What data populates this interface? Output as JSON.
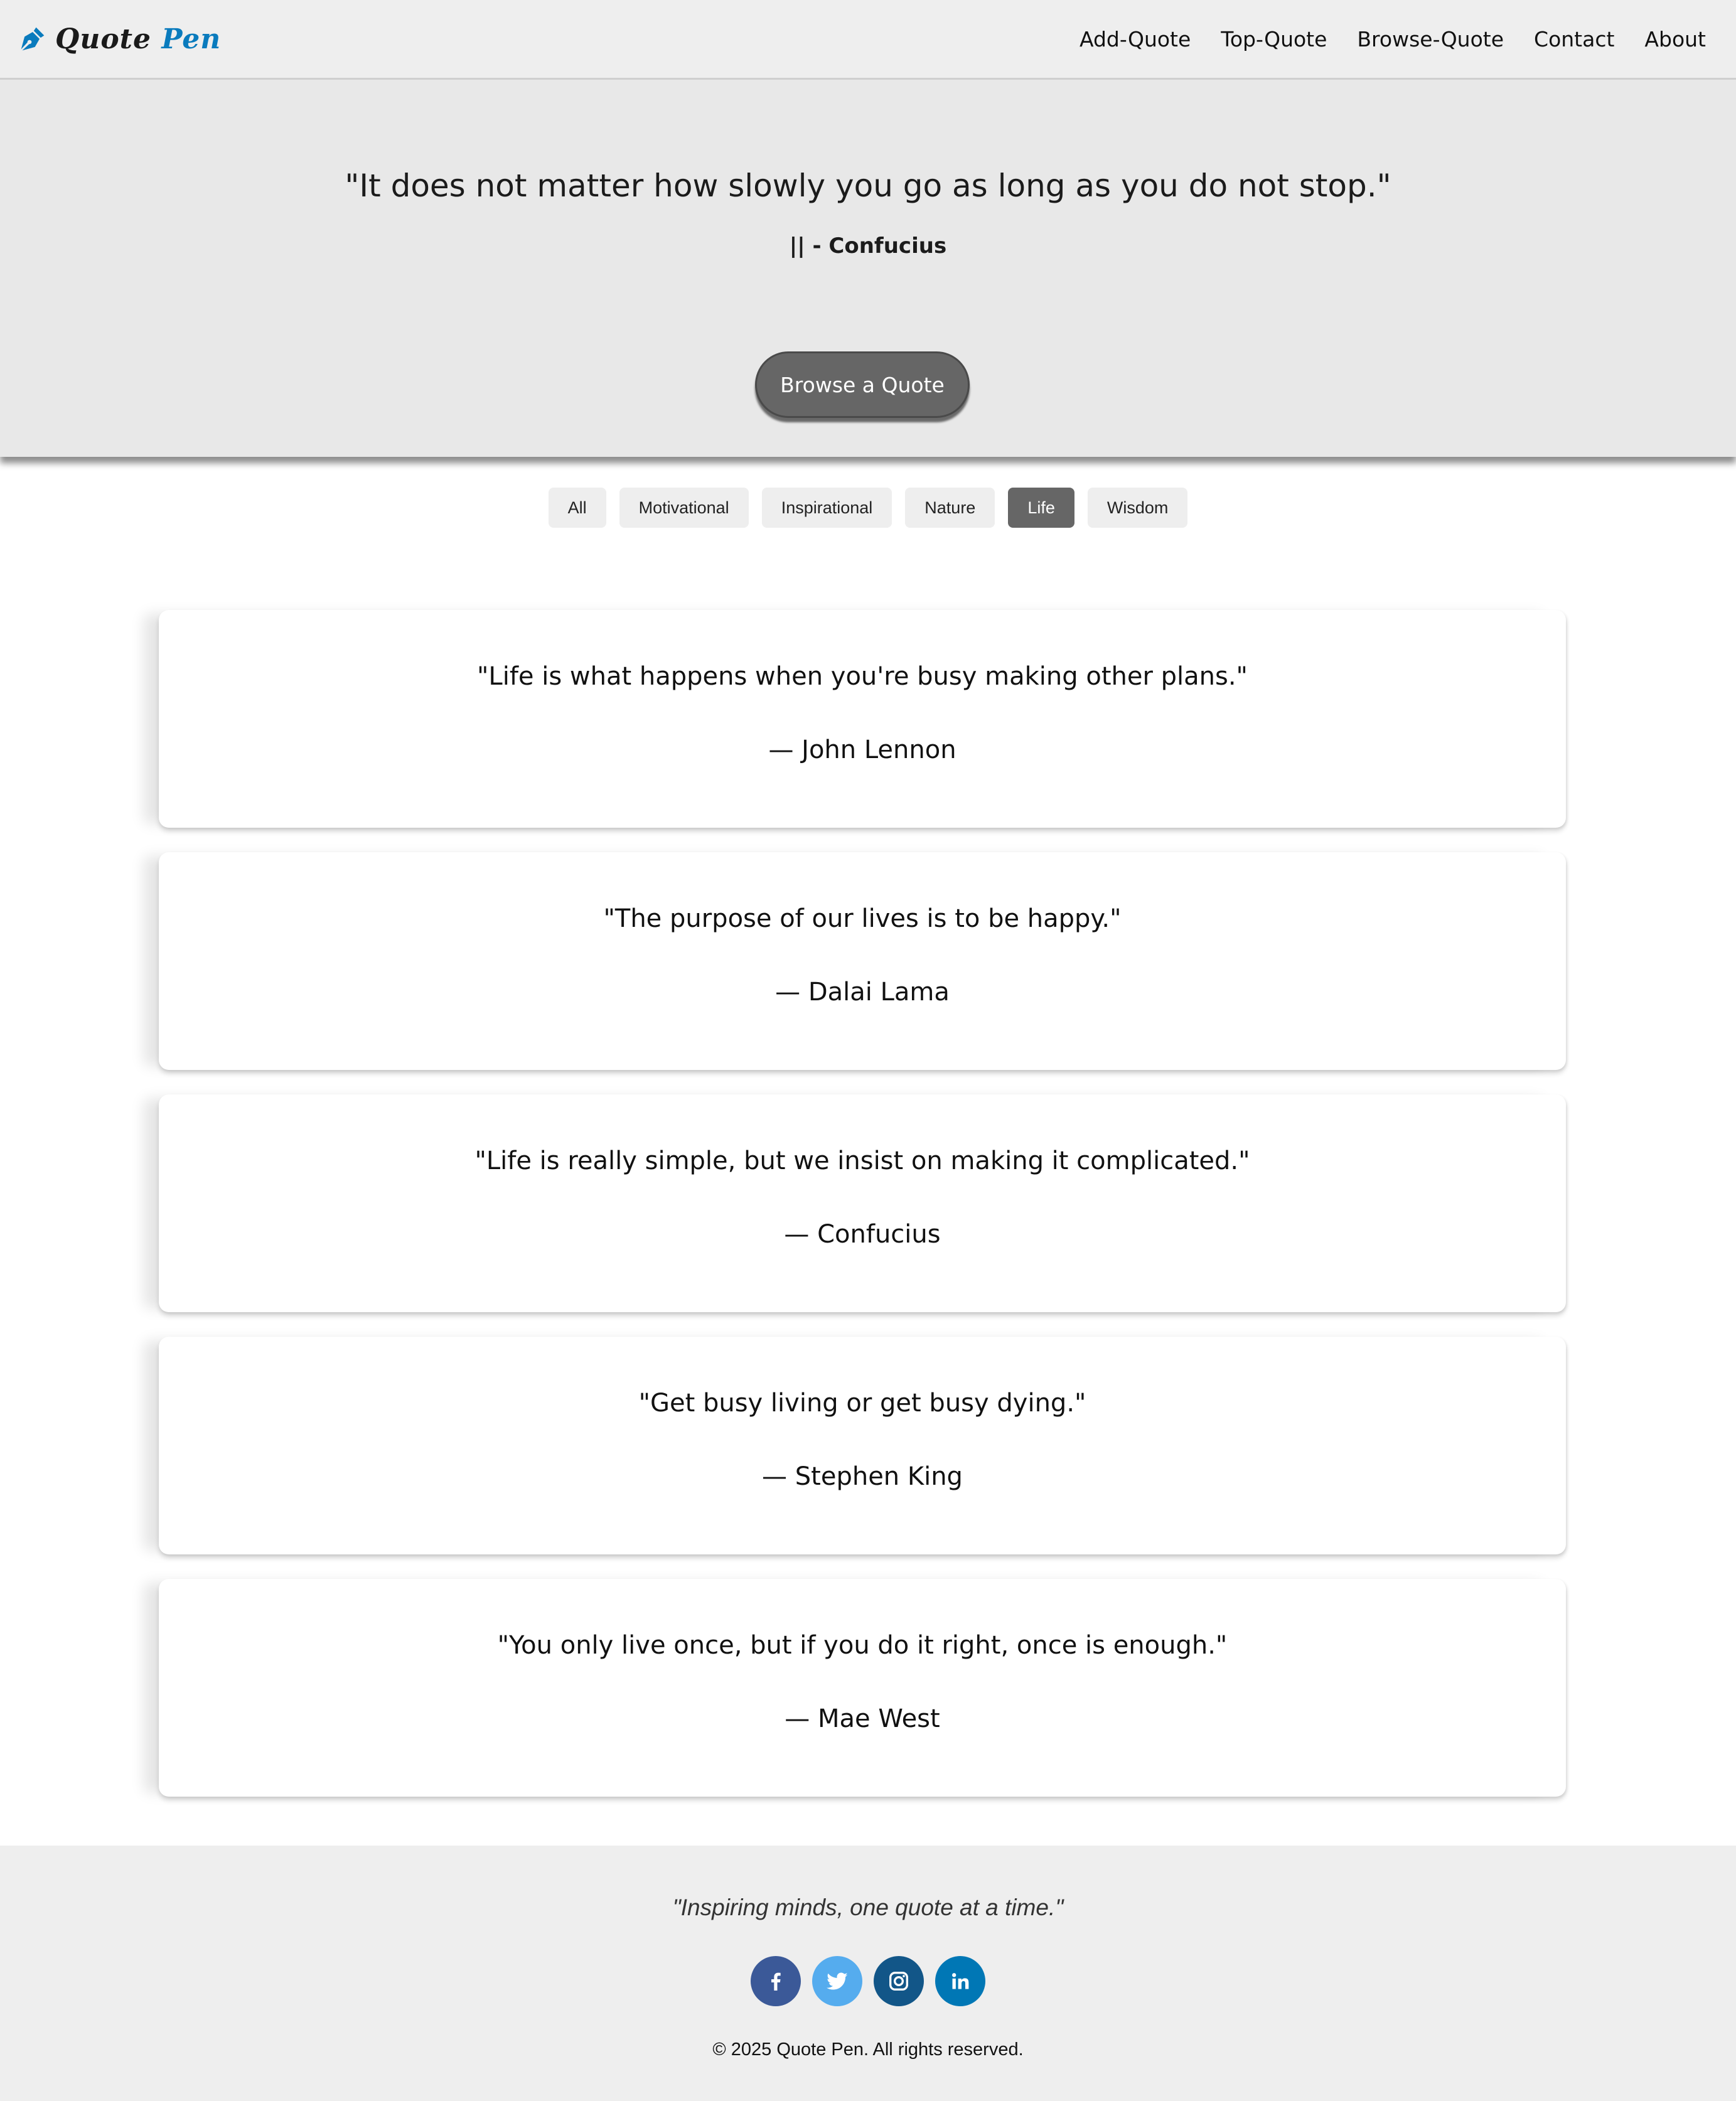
{
  "nav": {
    "brand_word1": "Quote",
    "brand_word2": "Pen",
    "brand_icon": "pen-nib-icon",
    "links": [
      "Add-Quote",
      "Top-Quote",
      "Browse-Quote",
      "Contact",
      "About"
    ]
  },
  "hero": {
    "quote": "\"It does not matter how slowly you go as long as you do not stop.\"",
    "author": "|| - Confucius",
    "button_label": "Browse a Quote"
  },
  "filters": {
    "items": [
      "All",
      "Motivational",
      "Inspirational",
      "Nature",
      "Life",
      "Wisdom"
    ],
    "active": "Life"
  },
  "quotes": [
    {
      "text": "\"Life is what happens when you're busy making other plans.\"",
      "author": "— John Lennon"
    },
    {
      "text": "\"The purpose of our lives is to be happy.\"",
      "author": "— Dalai Lama"
    },
    {
      "text": "\"Life is really simple, but we insist on making it complicated.\"",
      "author": "— Confucius"
    },
    {
      "text": "\"Get busy living or get busy dying.\"",
      "author": "— Stephen King"
    },
    {
      "text": "\"You only live once, but if you do it right, once is enough.\"",
      "author": "— Mae West"
    }
  ],
  "footer": {
    "tagline": "\"Inspiring minds, one quote at a time.\"",
    "socials": [
      {
        "icon": "facebook-icon",
        "color": "#3b5998"
      },
      {
        "icon": "twitter-icon",
        "color": "#55acee"
      },
      {
        "icon": "instagram-icon",
        "color": "#125688"
      },
      {
        "icon": "linkedin-icon",
        "color": "#0077b5"
      }
    ],
    "copyright": "© 2025 Quote Pen. All rights reserved."
  },
  "colors": {
    "brand_accent": "#0a7bbd",
    "button_gray": "#666666",
    "navbar_bg": "#eeeeee",
    "hero_bg": "#e8e8e8"
  }
}
